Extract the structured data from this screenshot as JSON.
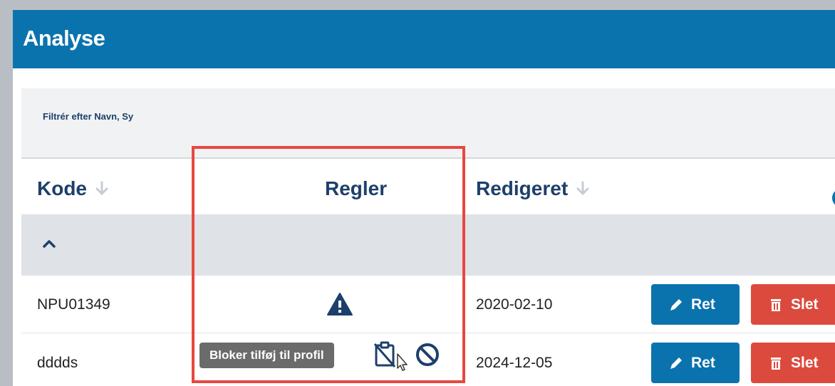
{
  "app": {
    "title": "Analyse"
  },
  "filter": {
    "label": "Filtrér efter Navn, Sy"
  },
  "table": {
    "columns": [
      {
        "label": "Kode",
        "sortable": true
      },
      {
        "label": "Regler",
        "sortable": false
      },
      {
        "label": "Redigeret",
        "sortable": true
      }
    ],
    "rows": [
      {
        "code": "NPU01349",
        "rule_icon": "warning-icon",
        "date": "2020-02-10",
        "edit_label": "Ret",
        "delete_label": "Slet"
      },
      {
        "code": "dddds",
        "rule_icons": [
          "clipboard-off-icon",
          "block-icon"
        ],
        "date": "2024-12-05",
        "edit_label": "Ret",
        "delete_label": "Slet",
        "tooltip": "Bloker tilføj til profil"
      }
    ]
  },
  "colors": {
    "header_blue": "#0a73ae",
    "heading_navy": "#1d3f6b",
    "delete_red": "#dc4a3d",
    "highlight_red": "#e8473f"
  }
}
